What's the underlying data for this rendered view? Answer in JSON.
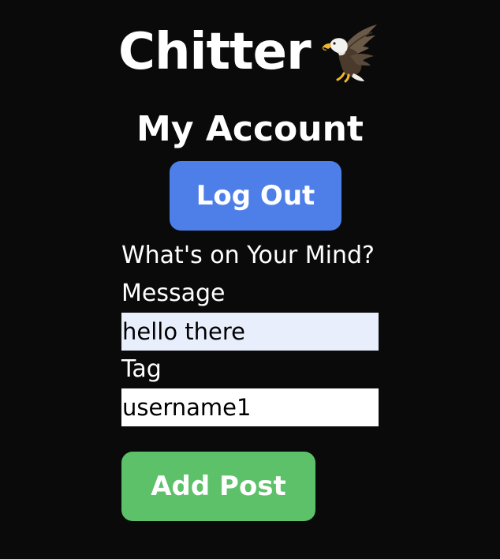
{
  "header": {
    "app_title": "Chitter",
    "logo_icon": "eagle-icon"
  },
  "account": {
    "title": "My Account",
    "logout_label": "Log Out"
  },
  "post_form": {
    "prompt": "What's on Your Mind?",
    "message_label": "Message",
    "message_value": "hello there",
    "tag_label": "Tag",
    "tag_value": "username1",
    "submit_label": "Add Post"
  },
  "colors": {
    "background": "#0a0a0a",
    "logout_button": "#4e7fe9",
    "add_post_button": "#5cc168",
    "message_field_bg": "#e8eefc"
  }
}
